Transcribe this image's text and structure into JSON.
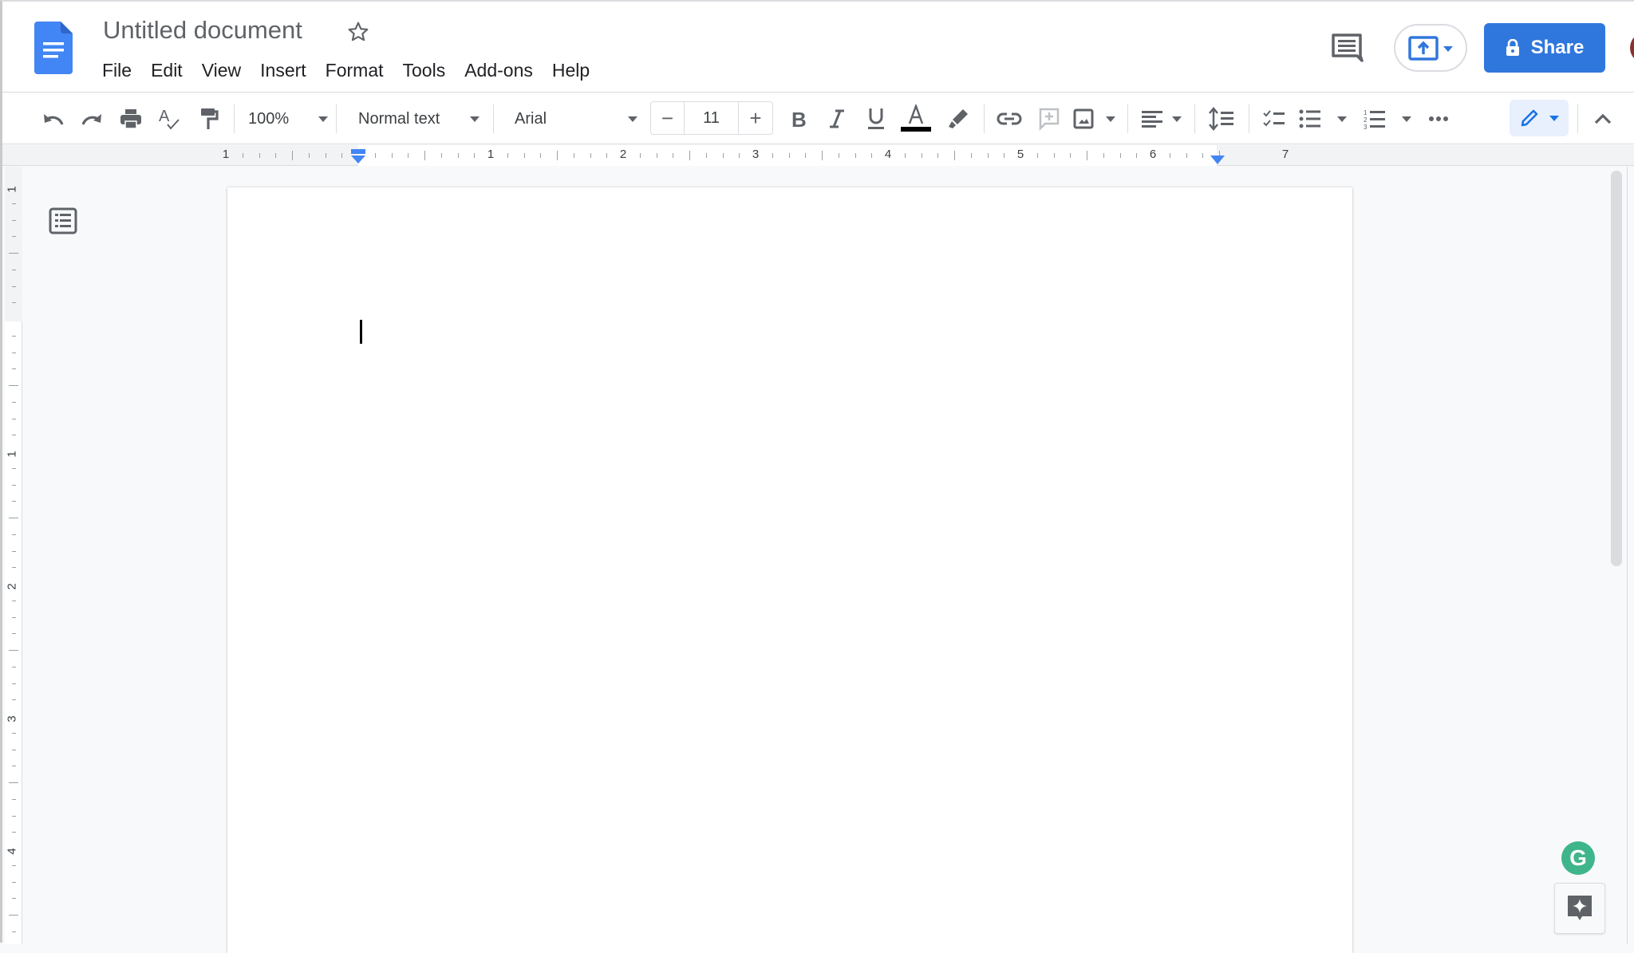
{
  "app": {
    "name": "Google Docs",
    "document_title": "Untitled document",
    "brand_color": "#4285f4",
    "share_color": "#3077dd"
  },
  "menu": {
    "items": [
      {
        "label": "File"
      },
      {
        "label": "Edit"
      },
      {
        "label": "View"
      },
      {
        "label": "Insert"
      },
      {
        "label": "Format"
      },
      {
        "label": "Tools"
      },
      {
        "label": "Add-ons"
      },
      {
        "label": "Help"
      }
    ]
  },
  "header": {
    "share_label": "Share",
    "star_icon": "star-outline-icon",
    "comment_icon": "comment-history-icon",
    "present_icon": "present-upload-icon",
    "lock_icon": "lock-icon"
  },
  "toolbar": {
    "zoom_value": "100%",
    "paragraph_style": "Normal text",
    "font_family": "Arial",
    "font_size": "11",
    "font_size_minus": "−",
    "font_size_plus": "+",
    "text_color": "#000000",
    "icons": [
      "undo-icon",
      "redo-icon",
      "print-icon",
      "spellcheck-icon",
      "paint-format-icon",
      "bold-icon",
      "italic-icon",
      "underline-icon",
      "text-color-icon",
      "highlight-icon",
      "link-icon",
      "add-comment-icon",
      "insert-image-icon",
      "align-icon",
      "line-spacing-icon",
      "checklist-icon",
      "bulleted-list-icon",
      "numbered-list-icon",
      "more-icon",
      "editing-mode-icon",
      "collapse-icon"
    ]
  },
  "ruler": {
    "horizontal_labels": [
      "1",
      "1",
      "2",
      "3",
      "4",
      "5",
      "6",
      "7"
    ],
    "vertical_labels": [
      "1",
      "1",
      "2",
      "3",
      "4"
    ]
  },
  "document": {
    "body_text": ""
  },
  "side": {
    "grammarly_label": "G",
    "outline_icon": "document-outline-icon",
    "explore_icon": "explore-sparkle-icon"
  }
}
